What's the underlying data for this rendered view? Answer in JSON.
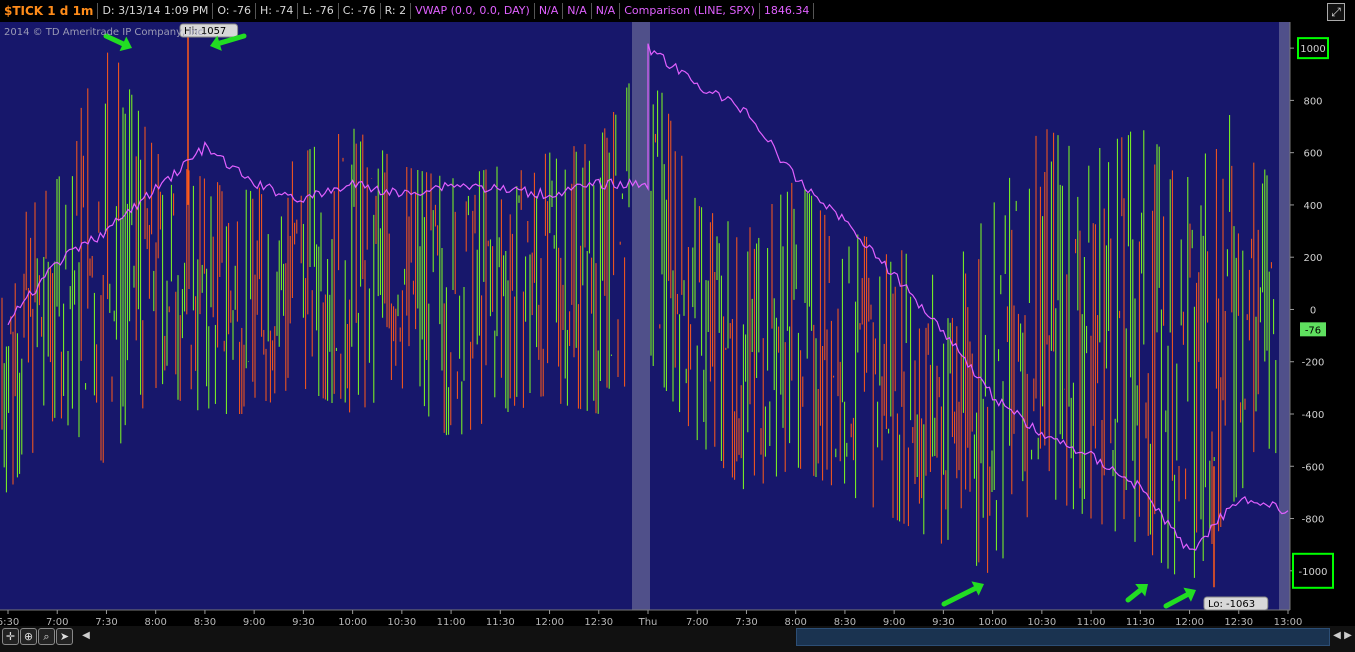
{
  "header": {
    "symbol": "$TICK 1 d 1m",
    "date": "D: 3/13/14 1:09 PM",
    "open": "O: -76",
    "high": "H: -74",
    "low": "L: -76",
    "close": "C: -76",
    "range": "R: 2",
    "vwap": "VWAP (0.0, 0.0, DAY)",
    "na1": "N/A",
    "na2": "N/A",
    "na3": "N/A",
    "comparison": "Comparison (LINE, SPX)",
    "comparison_value": "1846.34"
  },
  "watermark": "2014 © TD Ameritrade IP Company, Inc.",
  "callouts": {
    "hi": "Hi: 1057",
    "lo": "Lo: -1063",
    "last": "-76"
  },
  "colors": {
    "background": "#17176b",
    "up_bar": "#7fff20",
    "down_bar": "#ff5a1a",
    "vwap_line": "#e060ff",
    "highlight_box": "#00ff00",
    "arrow": "#22dd22",
    "session_band": "#50508a"
  },
  "chart_data": {
    "type": "line",
    "title": "$TICK 1 d 1m",
    "xlabel": "",
    "ylabel": "",
    "ylim": [
      -1150,
      1100
    ],
    "yticks": [
      1000,
      800,
      600,
      400,
      200,
      0,
      -200,
      -400,
      -600,
      -800,
      -1000
    ],
    "x_tick_labels": [
      "6:30",
      "7:00",
      "7:30",
      "8:00",
      "8:30",
      "9:00",
      "9:30",
      "10:00",
      "10:30",
      "11:00",
      "11:30",
      "12:00",
      "12:30",
      "Thu",
      "7:00",
      "7:30",
      "8:00",
      "8:30",
      "9:00",
      "9:30",
      "10:00",
      "10:30",
      "11:00",
      "11:30",
      "12:00",
      "12:30",
      "13:00"
    ],
    "highlighted_y_labels": [
      1000,
      -1000
    ],
    "series": [
      {
        "name": "Comparison (LINE, SPX)",
        "x": [
          "6:30",
          "7:00",
          "7:30",
          "8:00",
          "8:30",
          "9:00",
          "9:30",
          "10:00",
          "10:30",
          "11:00",
          "11:30",
          "12:00",
          "12:30",
          "Thu",
          "7:00",
          "7:30",
          "8:00",
          "8:30",
          "9:00",
          "9:30",
          "10:00",
          "10:30",
          "11:00",
          "11:30",
          "12:00",
          "12:30",
          "13:00"
        ],
        "values": [
          -50,
          180,
          300,
          460,
          620,
          480,
          420,
          480,
          440,
          480,
          460,
          440,
          480,
          1000,
          860,
          760,
          500,
          340,
          130,
          -80,
          -330,
          -480,
          -560,
          -680,
          -930,
          -720,
          -770
        ]
      },
      {
        "name": "$TICK",
        "x": [
          "6:30",
          "7:00",
          "7:30",
          "8:00",
          "8:30",
          "9:00",
          "9:30",
          "10:00",
          "10:30",
          "11:00",
          "11:30",
          "12:00",
          "12:30",
          "Thu",
          "7:00",
          "7:30",
          "8:00",
          "8:30",
          "9:00",
          "9:30",
          "10:00",
          "10:30",
          "11:00",
          "11:30",
          "12:00",
          "12:30",
          "13:00"
        ],
        "high": [
          300,
          500,
          1057,
          600,
          500,
          450,
          600,
          700,
          550,
          500,
          550,
          600,
          650,
          1000,
          400,
          300,
          500,
          300,
          250,
          100,
          400,
          700,
          600,
          700,
          500,
          800,
          300
        ],
        "low": [
          -700,
          -400,
          -600,
          -300,
          -400,
          -400,
          -300,
          -400,
          -300,
          -500,
          -400,
          -350,
          -400,
          -200,
          -500,
          -700,
          -600,
          -700,
          -800,
          -900,
          -1020,
          -700,
          -800,
          -900,
          -1063,
          -700,
          -500
        ]
      }
    ],
    "hi": 1057,
    "lo": -1063,
    "last": -76
  }
}
